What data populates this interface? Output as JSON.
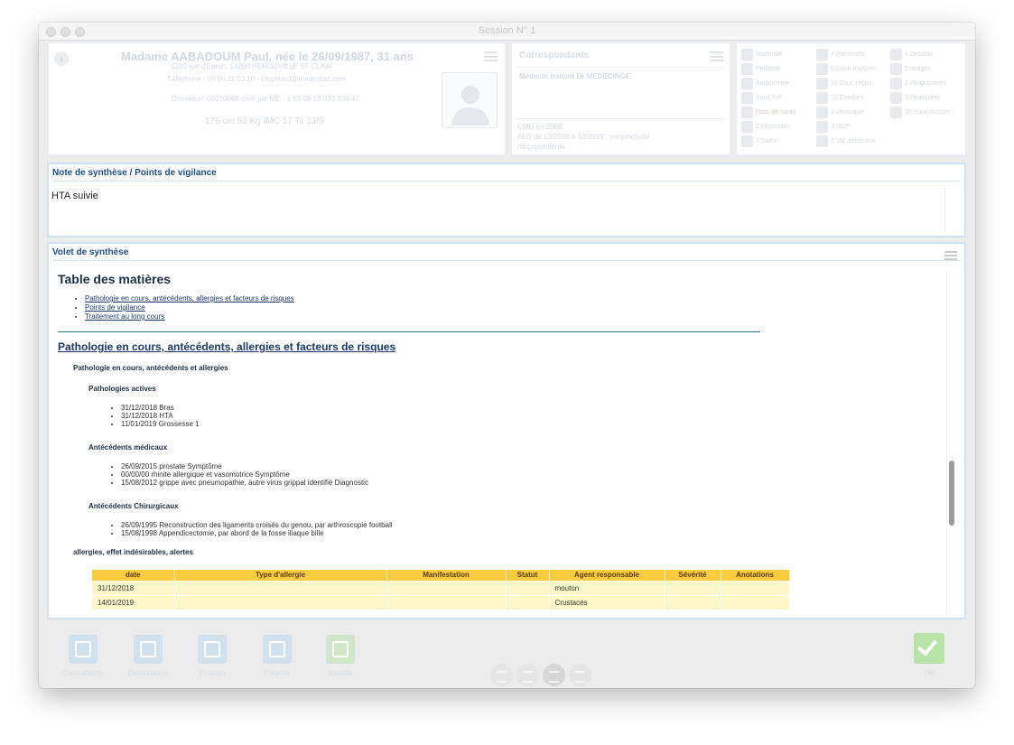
{
  "window": {
    "title": "Session N° 1"
  },
  "patient": {
    "name": "Madame AABADOUM Paul, née le 26/09/1987, 31 ans",
    "address": "1280 rue d'Epron, 14200 HEROUVILLE ST CLAIR",
    "contact": "Téléphone : 09 06 11 03 10 - t.lepinard@medimust.com",
    "dossier": "Dossier n° 00010066 créé par ME - 1 65 09 18 033 139 47",
    "metrics": "176 cm  52 Kg  IMC 17   Ts 13/9"
  },
  "correspondants": {
    "title": "Correspondants",
    "doctor": "Médecin traitant Dr MEDECINGE",
    "cmu": "CMU en 2008",
    "ald_line1": "ALD de 10/2018 à 10/2019 : conjonctivite",
    "ald_line2": "mucopurulente"
  },
  "quick_links": [
    {
      "label": "Maternité",
      "icon": "maternity-icon"
    },
    {
      "label": "7 Préventifs",
      "icon": "prevention-icon"
    },
    {
      "label": "4 Dessins",
      "icon": "drawing-icon"
    },
    {
      "label": "Pédiatrie",
      "icon": "pediatrics-icon"
    },
    {
      "label": "5 Cour. envoyés",
      "icon": "mail-sent-icon"
    },
    {
      "label": "5 Images",
      "icon": "image-icon"
    },
    {
      "label": "Audiométrie",
      "icon": "audiometry-icon"
    },
    {
      "label": "11 Cour. reçus",
      "icon": "mail-received-icon"
    },
    {
      "label": "2 Programmes",
      "icon": "program-icon"
    },
    {
      "label": "Suivi INR",
      "icon": "inr-icon"
    },
    {
      "label": "15 Courbes",
      "icon": "curve-icon"
    },
    {
      "label": "3 Protocoles",
      "icon": "protocol-icon"
    },
    {
      "label": "Fact. de santé",
      "icon": "health-factor-icon",
      "alert": true
    },
    {
      "label": "1 chronique",
      "icon": "chronic-icon"
    },
    {
      "label": "15 Sous-dossier",
      "icon": "subfolder-icon"
    },
    {
      "label": "2 Dispositifs",
      "icon": "device-icon"
    },
    {
      "label": "3 RCP",
      "icon": "rcp-icon"
    },
    {
      "label": "",
      "icon": ""
    },
    {
      "label": "3 Soins",
      "icon": "care-icon"
    },
    {
      "label": "2 Vol. médicaux",
      "icon": "medical-volume-icon"
    }
  ],
  "note": {
    "title": "Note de synthèse / Points de vigilance",
    "text": "HTA suivie"
  },
  "volet": {
    "title": "Volet de synthèse",
    "toc_title": "Table des matières",
    "toc": [
      "Pathologie en cours, antécédents, allergies et facteurs de risques",
      "Points de vigilance",
      "Traitement au long cours"
    ],
    "section_title": "Pathologie en cours, antécédents, allergies et facteurs de risques",
    "subsection_title": "Pathologie en cours, antécédents et allergies",
    "pathologies_title": "Pathologies actives",
    "pathologies": [
      "31/12/2018 Bras",
      "31/12/2018 HTA",
      "11/01/2019 Grossesse 1"
    ],
    "medical_title": "Antécédents médicaux",
    "medical": [
      "26/09/2015 prostate Symptôme",
      "00/00/00 rhinite allergique et vasomotrice Symptôme",
      "15/08/2012 grippe avec pneumopathie, autre virus grippal identifié Diagnostic"
    ],
    "surgical_title": "Antécédents Chirurgicaux",
    "surgical": [
      "26/09/1995 Reconstruction des ligaments croisés du genou, par arthroscopie football",
      "15/08/1998 Appendicectomie, par abord de la fosse iliaque bille"
    ],
    "allergies_title": "allergies, effet indésirables, alertes",
    "allergy_columns": [
      "date",
      "Type d'allergie",
      "Manifestation",
      "Statut",
      "Agent responsable",
      "Sévérité",
      "Anotations"
    ],
    "allergy_rows": [
      [
        "31/12/2018",
        "",
        "",
        "",
        "mouton",
        "",
        ""
      ],
      [
        "14/01/2019",
        "",
        "",
        "",
        "Crustacés",
        "",
        ""
      ]
    ]
  },
  "toolbar": [
    {
      "label": "Consultation",
      "icon": "stethoscope-icon"
    },
    {
      "label": "Ordonnance",
      "icon": "prescription-icon"
    },
    {
      "label": "Examen",
      "icon": "flask-icon"
    },
    {
      "label": "Courrier",
      "icon": "letter-icon"
    },
    {
      "label": "Recette",
      "icon": "vitale-card-icon"
    }
  ],
  "ok_label": "OK"
}
